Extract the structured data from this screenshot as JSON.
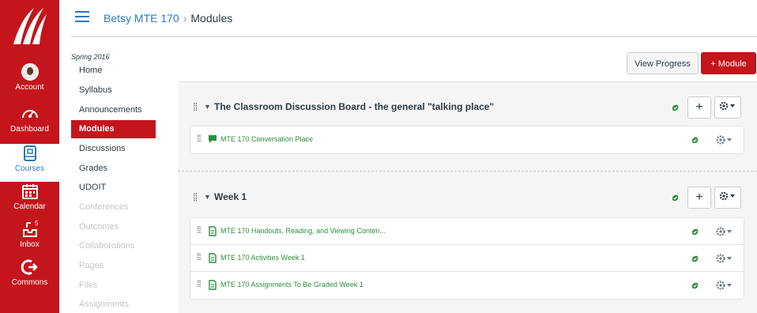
{
  "global_nav": {
    "account": "Account",
    "dashboard": "Dashboard",
    "courses": "Courses",
    "calendar": "Calendar",
    "inbox": "Inbox",
    "inbox_count": "5",
    "commons": "Commons"
  },
  "breadcrumb": {
    "course": "Betsy MTE 170",
    "separator": "›",
    "current": "Modules"
  },
  "course_nav": {
    "term": "Spring 2016",
    "items": [
      {
        "label": "Home"
      },
      {
        "label": "Syllabus"
      },
      {
        "label": "Announcements"
      },
      {
        "label": "Modules"
      },
      {
        "label": "Discussions"
      },
      {
        "label": "Grades"
      },
      {
        "label": "UDOIT"
      },
      {
        "label": "Conferences"
      },
      {
        "label": "Outcomes"
      },
      {
        "label": "Collaborations"
      },
      {
        "label": "Pages"
      },
      {
        "label": "Files"
      },
      {
        "label": "Assignments"
      }
    ]
  },
  "buttons": {
    "view_progress": "View Progress",
    "add_module": "+ Module"
  },
  "modules": [
    {
      "title": "The Classroom Discussion Board - the general \"talking place\"",
      "items": [
        {
          "label": "MTE 170 Conversation Place",
          "type": "discussion"
        }
      ]
    },
    {
      "title": "Week 1",
      "items": [
        {
          "label": "MTE 170 Handouts, Reading, and Viewing Conten...",
          "type": "page"
        },
        {
          "label": "MTE 170 Activities Week 1",
          "type": "page"
        },
        {
          "label": "MTE 170 Assignments To Be Graded Week 1",
          "type": "page"
        }
      ]
    }
  ],
  "colors": {
    "brand_red": "#c4151c",
    "link_blue": "#2b7abc",
    "complete_green": "#2d8f3c"
  }
}
